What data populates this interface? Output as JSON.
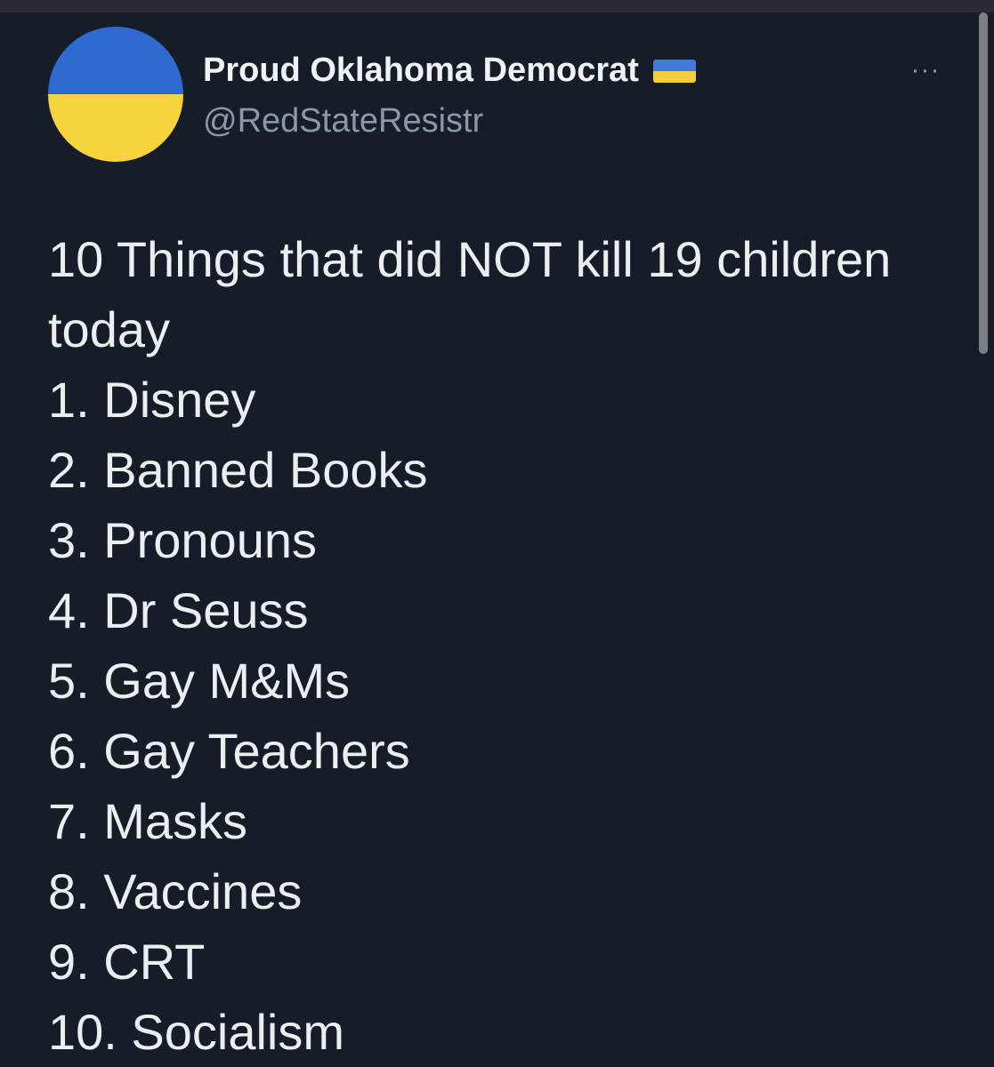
{
  "tweet": {
    "author": {
      "display_name": "Proud Oklahoma Democrat",
      "handle": "@RedStateResistr",
      "avatar_colors": {
        "top": "#2f6ad1",
        "bottom": "#f7d33d"
      },
      "badge_icon": "ukraine-flag-icon"
    },
    "more_label": "···",
    "lines": [
      "10 Things that did NOT kill 19 children",
      "today",
      "1. Disney",
      "2. Banned Books",
      "3. Pronouns",
      "4. Dr Seuss",
      "5. Gay M&Ms",
      "6. Gay Teachers",
      "7. Masks",
      "8. Vaccines",
      "9. CRT",
      "10. Socialism"
    ]
  },
  "theme": {
    "background": "#161c28",
    "text": "#eceff1",
    "secondary_text": "#8b98a5"
  }
}
